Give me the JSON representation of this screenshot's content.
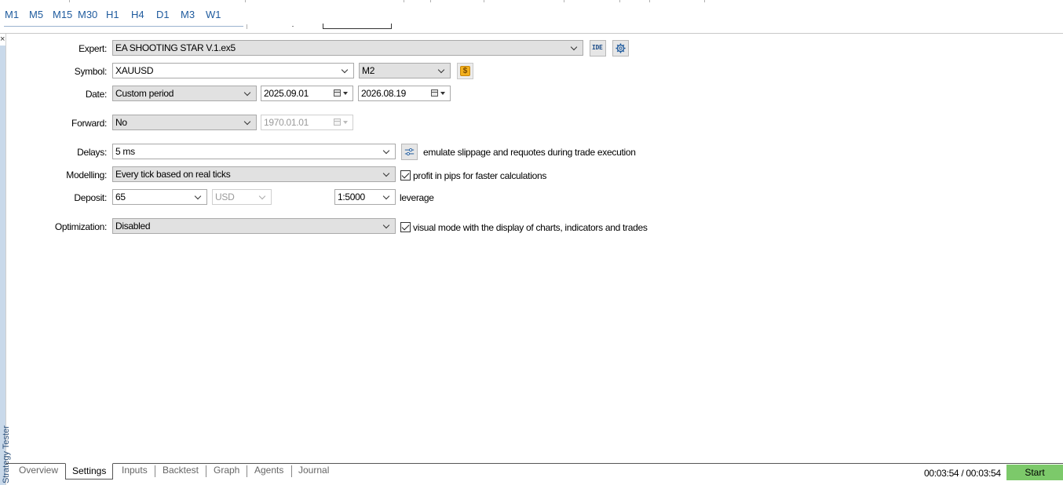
{
  "timeframes": [
    "M1",
    "M5",
    "M15",
    "M30",
    "H1",
    "H4",
    "D1",
    "M3",
    "W1"
  ],
  "side_panel": {
    "label": "Strategy Tester"
  },
  "form": {
    "expert": {
      "label": "Expert:",
      "value": "EA SHOOTING STAR V.1.ex5",
      "ide_label": "IDE"
    },
    "symbol": {
      "label": "Symbol:",
      "value": "XAUUSD",
      "period": "M2"
    },
    "date": {
      "label": "Date:",
      "mode": "Custom period",
      "from": "2025.09.01",
      "to": "2026.08.19"
    },
    "forward": {
      "label": "Forward:",
      "value": "No",
      "date": "1970.01.01"
    },
    "delays": {
      "label": "Delays:",
      "value": "5 ms",
      "note": "emulate slippage and requotes during trade execution"
    },
    "modelling": {
      "label": "Modelling:",
      "value": "Every tick based on real ticks",
      "checkbox_label": "profit in pips for faster calculations",
      "checked": true
    },
    "deposit": {
      "label": "Deposit:",
      "amount": "65",
      "currency": "USD",
      "leverage": "1:5000",
      "leverage_label": "leverage"
    },
    "optimization": {
      "label": "Optimization:",
      "value": "Disabled",
      "checkbox_label": "visual mode with the display of charts, indicators and trades",
      "checked": true
    }
  },
  "tabs": [
    "Overview",
    "Settings",
    "Inputs",
    "Backtest",
    "Graph",
    "Agents",
    "Journal"
  ],
  "active_tab": "Settings",
  "footer": {
    "timer": "00:03:54 / 00:03:54",
    "start_label": "Start"
  },
  "colors": {
    "accent": "#1f5b9e",
    "start_button": "#7cc96a",
    "dropdown_bg": "#e1e1e1"
  }
}
